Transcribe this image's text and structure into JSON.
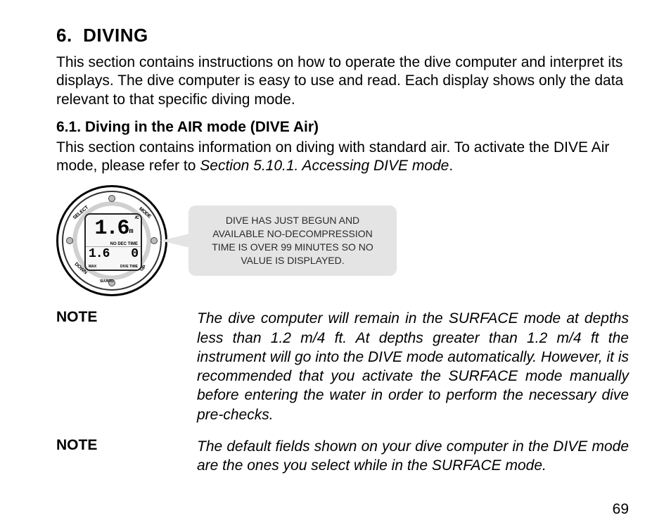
{
  "chapter": {
    "number": "6.",
    "title": "DIVING"
  },
  "intro": "This section contains instructions on how to operate the dive computer and interpret its displays. The dive computer is easy to use and read. Each display shows only the data relevant to that specific diving mode.",
  "section": {
    "number": "6.1.",
    "title": "Diving in the AIR mode (DIVE Air)",
    "para_before_xref": "This section contains information on diving with standard air. To activate the DIVE Air mode, please refer to ",
    "xref": "Section 5.10.1. Accessing DIVE mode",
    "para_after_xref": "."
  },
  "watch": {
    "buttons": {
      "select": "SELECT",
      "mode": "MODE",
      "down": "DOWN",
      "up": "UP"
    },
    "brand": "SUUNTO",
    "display": {
      "ac": "AC",
      "depth_value": "1.6",
      "depth_unit": "m",
      "no_dec_label": "NO DEC TIME",
      "bottom_left": "1.6",
      "bottom_right": "0",
      "bottom_left_label": "MAX",
      "bottom_right_label": "DIVE TIME"
    }
  },
  "callout": "DIVE HAS JUST BEGUN AND AVAILABLE NO-DECOMPRESSION TIME IS OVER 99 MINUTES SO NO VALUE IS DISPLAYED.",
  "notes": [
    {
      "label": "NOTE",
      "text": "The dive computer will remain in the SURFACE mode at depths less than 1.2 m/4 ft. At depths greater than 1.2 m/4 ft the instrument will go into the DIVE mode automatically. However, it is recommended that you activate the SURFACE mode manually before entering the water in order to perform the necessary dive pre-checks."
    },
    {
      "label": "NOTE",
      "text": "The default fields shown on your dive computer in the DIVE mode are the ones you select while in the SURFACE mode."
    }
  ],
  "page_number": "69"
}
